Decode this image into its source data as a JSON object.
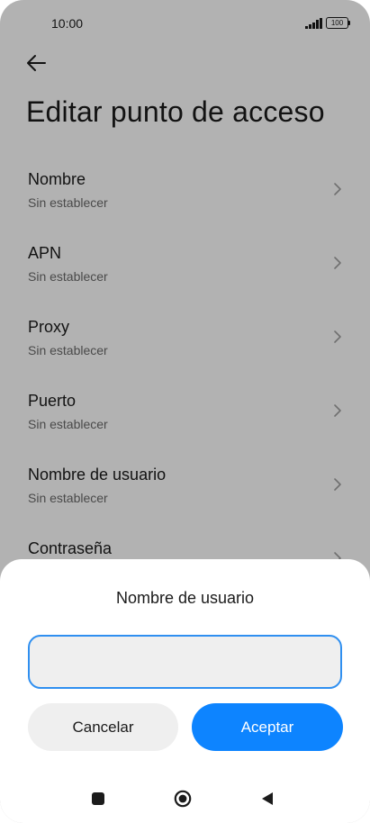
{
  "status_bar": {
    "time": "10:00",
    "battery": "100",
    "icons": [
      "signal-icon",
      "battery-icon"
    ]
  },
  "header": {
    "back_icon": "arrow-left-icon",
    "title": "Editar punto de acceso"
  },
  "settings": {
    "rows": [
      {
        "label": "Nombre",
        "value": "Sin establecer"
      },
      {
        "label": "APN",
        "value": "Sin establecer"
      },
      {
        "label": "Proxy",
        "value": "Sin establecer"
      },
      {
        "label": "Puerto",
        "value": "Sin establecer"
      },
      {
        "label": "Nombre de usuario",
        "value": "Sin establecer"
      },
      {
        "label": "Contraseña",
        "value": ""
      }
    ]
  },
  "dialog": {
    "title": "Nombre de usuario",
    "input_value": "",
    "cancel_label": "Cancelar",
    "accept_label": "Aceptar"
  },
  "colors": {
    "accent": "#0d84ff",
    "input_border": "#2f8ff0",
    "secondary_button": "#efefef"
  },
  "nav_bar": {
    "icons": [
      "recents-square-icon",
      "home-circle-icon",
      "back-triangle-icon"
    ]
  }
}
